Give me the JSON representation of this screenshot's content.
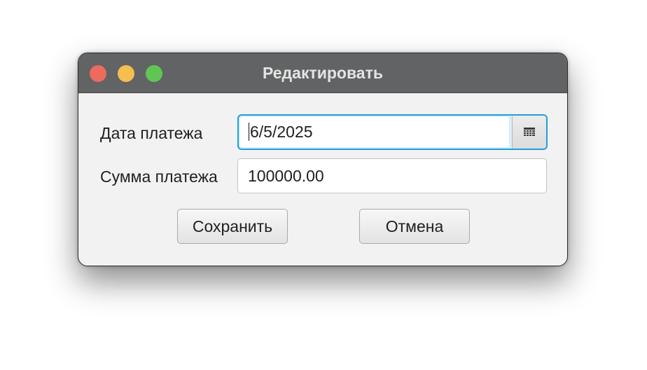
{
  "window": {
    "title": "Редактировать"
  },
  "form": {
    "date_label": "Дата платежа",
    "date_value": "6/5/2025",
    "amount_label": "Сумма платежа",
    "amount_value": "100000.00"
  },
  "buttons": {
    "save_label": "Сохранить",
    "cancel_label": "Отмена"
  },
  "icons": {
    "calendar": "calendar-icon"
  },
  "colors": {
    "focus_accent": "#1ea0d8",
    "titlebar": "#626364",
    "close": "#ec6a5e",
    "minimize": "#f4bf4f",
    "zoom": "#61c554"
  }
}
